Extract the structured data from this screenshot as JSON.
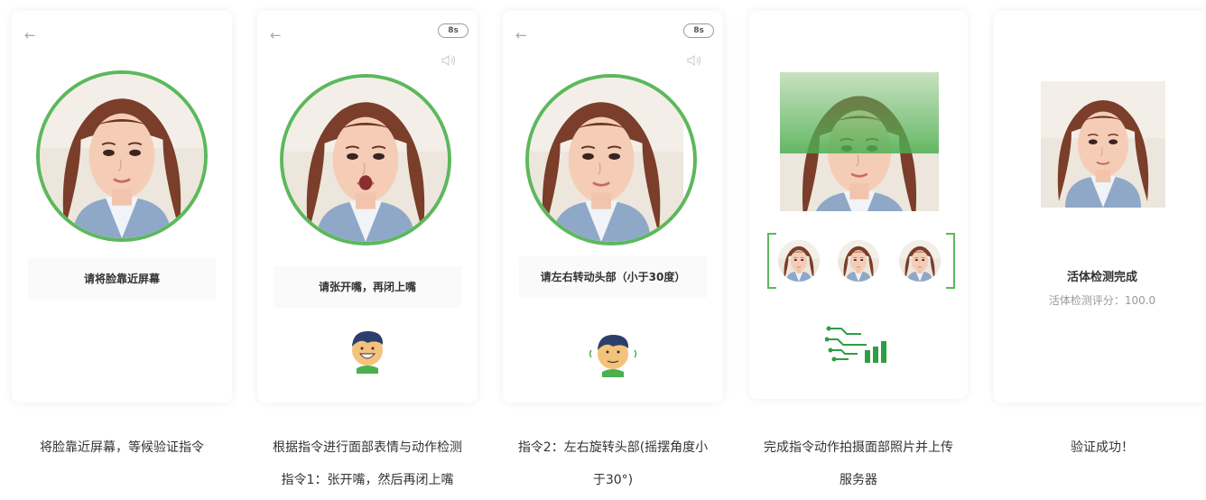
{
  "cards": [
    {
      "prompt": "请将脸靠近屏幕",
      "caption_line1": "将脸靠近屏幕，等候验证指令"
    },
    {
      "timer": "8s",
      "prompt": "请张开嘴，再闭上嘴",
      "caption_line1": "根据指令进行面部表情与动作检测",
      "caption_line2": "指令1：张开嘴，然后再闭上嘴"
    },
    {
      "timer": "8s",
      "prompt": "请左右转动头部（小于30度）",
      "caption_line1": "指令2：左右旋转头部(摇摆角度小",
      "caption_line2": "于30°)"
    },
    {
      "caption_line1": "完成指令动作拍摄面部照片并上传",
      "caption_line2": "服务器"
    },
    {
      "title": "活体检测完成",
      "score": "活体检测评分：100.0",
      "caption_line1": "验证成功！"
    }
  ],
  "colors": {
    "accent": "#5cb85c",
    "logo": "#2e9e44"
  },
  "icons": [
    "back-arrow-icon",
    "speaker-icon",
    "cartoon-avatar-icon",
    "circuit-logo-icon"
  ]
}
